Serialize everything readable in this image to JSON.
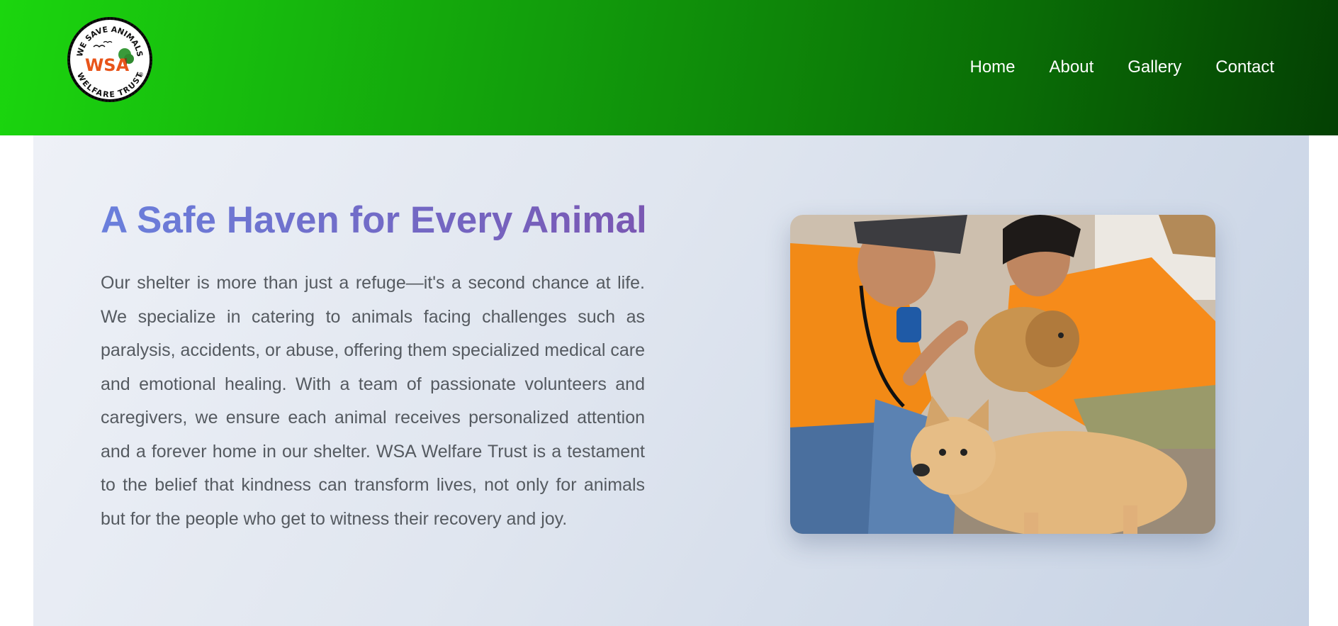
{
  "logo": {
    "top_text": "WE SAVE ANIMALS",
    "mark": "WSA",
    "bottom_text": "WELFARE TRUST",
    "registered": "®"
  },
  "nav": {
    "items": [
      {
        "label": "Home"
      },
      {
        "label": "About"
      },
      {
        "label": "Gallery"
      },
      {
        "label": "Contact"
      }
    ]
  },
  "hero": {
    "title": "A Safe Haven for Every Animal",
    "paragraph": "Our shelter is more than just a refuge—it's a second chance at life. We specialize in catering to animals facing challenges such as paralysis, accidents, or abuse, offering them specialized medical care and emotional healing. With a team of passionate volunteers and caregivers, we ensure each animal receives personalized attention and a forever home in our shelter. WSA Welfare Trust is a testament to the belief that kindness can transform lives, not only for animals but for the people who get to witness their recovery and joy."
  },
  "colors": {
    "header_start": "#1bd60e",
    "header_end": "#044003",
    "title_start": "#6a7fdc",
    "title_end": "#7a57b2",
    "body_text": "#555a60"
  }
}
